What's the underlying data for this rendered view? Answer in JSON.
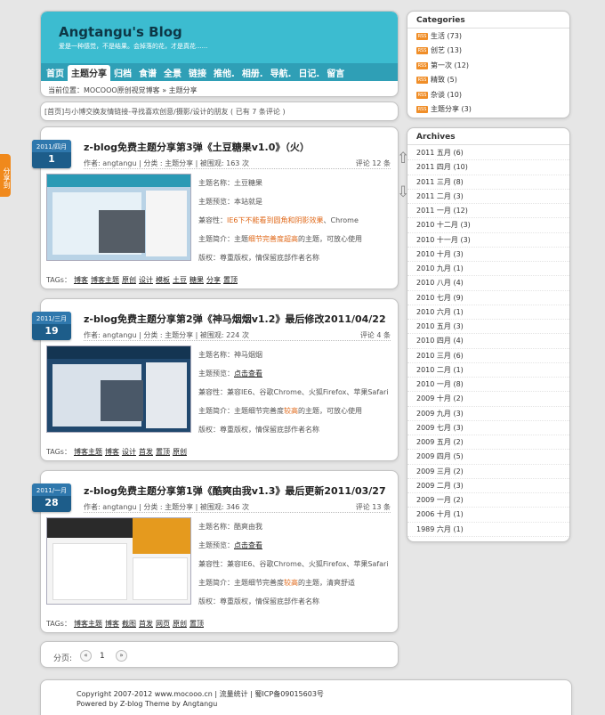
{
  "header": {
    "title": "Angtangu's Blog",
    "subtitle": "爱是一种感觉，不是结果。会掉落的花，才是真花......",
    "nav": [
      "首页",
      "主题分享",
      "归档",
      "食谱",
      "全景",
      "链接",
      "推他.",
      "相册.",
      "导航.",
      "日记.",
      "留言"
    ],
    "active_nav": "主题分享",
    "breadcrumb": "当前位置：MOCOOO原创视觉博客 » 主题分享"
  },
  "notice": "[首页]与小博交换友情链接-寻找喜欢创意/摄影/设计的朋友 ( 已有 7 条评论 )",
  "share_tab": "分享到",
  "posts": [
    {
      "date_month": "2011/四月",
      "date_day": "1",
      "title": "z-blog免费主题分享第3弹《土豆糖果v1.0》（火）",
      "meta": "作者: angtangu | 分类 : 主题分享 | 被围观: 163 次",
      "comments": "评论 12 条",
      "line1": "主题名称：土豆糖果",
      "line2": "主题预览：本站就是",
      "line3_prefix": "兼容性：",
      "line3_hi": "IE6下不能看到圆角和阴影效果",
      "line3_suffix": "、Chrome",
      "line4_prefix": "主题简介：主题",
      "line4_hi": "细节完善度超高",
      "line4_suffix": "的主题，可放心使用",
      "line5": "版权：尊重版权，情保留底部作者名称",
      "tags_label": "TAGs：",
      "tags": [
        "博客",
        "博客主题",
        "原创",
        "设计",
        "模板",
        "土豆",
        "糖果",
        "分享",
        "置顶"
      ]
    },
    {
      "date_month": "2011/三月",
      "date_day": "19",
      "title": "z-blog免费主题分享第2弹《神马烟烟v1.2》最后修改2011/04/22",
      "meta": "作者: angtangu | 分类 : 主题分享 | 被围观: 224 次",
      "comments": "评论 4 条",
      "line1": "主题名称：神马烟烟",
      "line2_prefix": "主题预览：",
      "line2_link": "点击查看",
      "line3": "兼容性：兼容IE6、谷歌Chrome、火狐Firefox、苹果Safari",
      "line4_prefix": "主题简介：主题细节完善度",
      "line4_hi": "较高",
      "line4_suffix": "的主题，可放心使用",
      "line5": "版权：尊重版权，情保留底部作者名称",
      "tags_label": "TAGs：",
      "tags": [
        "博客主题",
        "博客",
        "设计",
        "首发",
        "置顶",
        "原创"
      ]
    },
    {
      "date_month": "2011/一月",
      "date_day": "28",
      "title": "z-blog免费主题分享第1弹《酷爽由我v1.3》最后更新2011/03/27",
      "meta": "作者: angtangu | 分类 : 主题分享 | 被围观: 346 次",
      "comments": "评论 13 条",
      "line1": "主题名称：酷爽由我",
      "line2_prefix": "主题预览：",
      "line2_link": "点击查看",
      "line3": "兼容性：兼容IE6、谷歌Chrome、火狐Firefox、苹果Safari",
      "line4_prefix": "主题简介：主题细节完善度",
      "line4_hi": "较高",
      "line4_suffix": "的主题，清爽舒适",
      "line5": "版权：尊重版权，情保留底部作者名称",
      "tags_label": "TAGs：",
      "tags": [
        "博客主题",
        "博客",
        "截图",
        "首发",
        "网页",
        "原创",
        "置顶"
      ]
    }
  ],
  "pager": {
    "label": "分页:",
    "prev": "«",
    "current": "1",
    "next": "»"
  },
  "footer": {
    "line1": "Copyright 2007-2012 www.mocooo.cn | 流量统计 | 蜀ICP备09015603号",
    "line2": "Powered by Z-blog Theme by Angtangu"
  },
  "sidebar": {
    "categories_title": "Categories",
    "rss_badge": "RSS",
    "categories": [
      "生活 (73)",
      "创艺 (13)",
      "第一次 (12)",
      "精致 (5)",
      "杂谈 (10)",
      "主题分享 (3)"
    ],
    "archives_title": "Archives",
    "archives": [
      "2011 五月 (6)",
      "2011 四月 (10)",
      "2011 三月 (8)",
      "2011 二月 (3)",
      "2011 一月 (12)",
      "2010 十二月 (3)",
      "2010 十一月 (3)",
      "2010 十月 (3)",
      "2010 九月 (1)",
      "2010 八月 (4)",
      "2010 七月 (9)",
      "2010 六月 (1)",
      "2010 五月 (3)",
      "2010 四月 (4)",
      "2010 三月 (6)",
      "2010 二月 (1)",
      "2010 一月 (8)",
      "2009 十月 (2)",
      "2009 九月 (3)",
      "2009 七月 (3)",
      "2009 五月 (2)",
      "2009 四月 (5)",
      "2009 三月 (2)",
      "2009 二月 (3)",
      "2009 一月 (2)",
      "2006 十月 (1)",
      "1989 六月 (1)"
    ]
  },
  "colors": {
    "banner": "#3cbcd0",
    "nav": "#2f9fb6",
    "date_badge": "#1d5d8a",
    "highlight": "#e06a1b",
    "share_tab": "#f0891c"
  }
}
